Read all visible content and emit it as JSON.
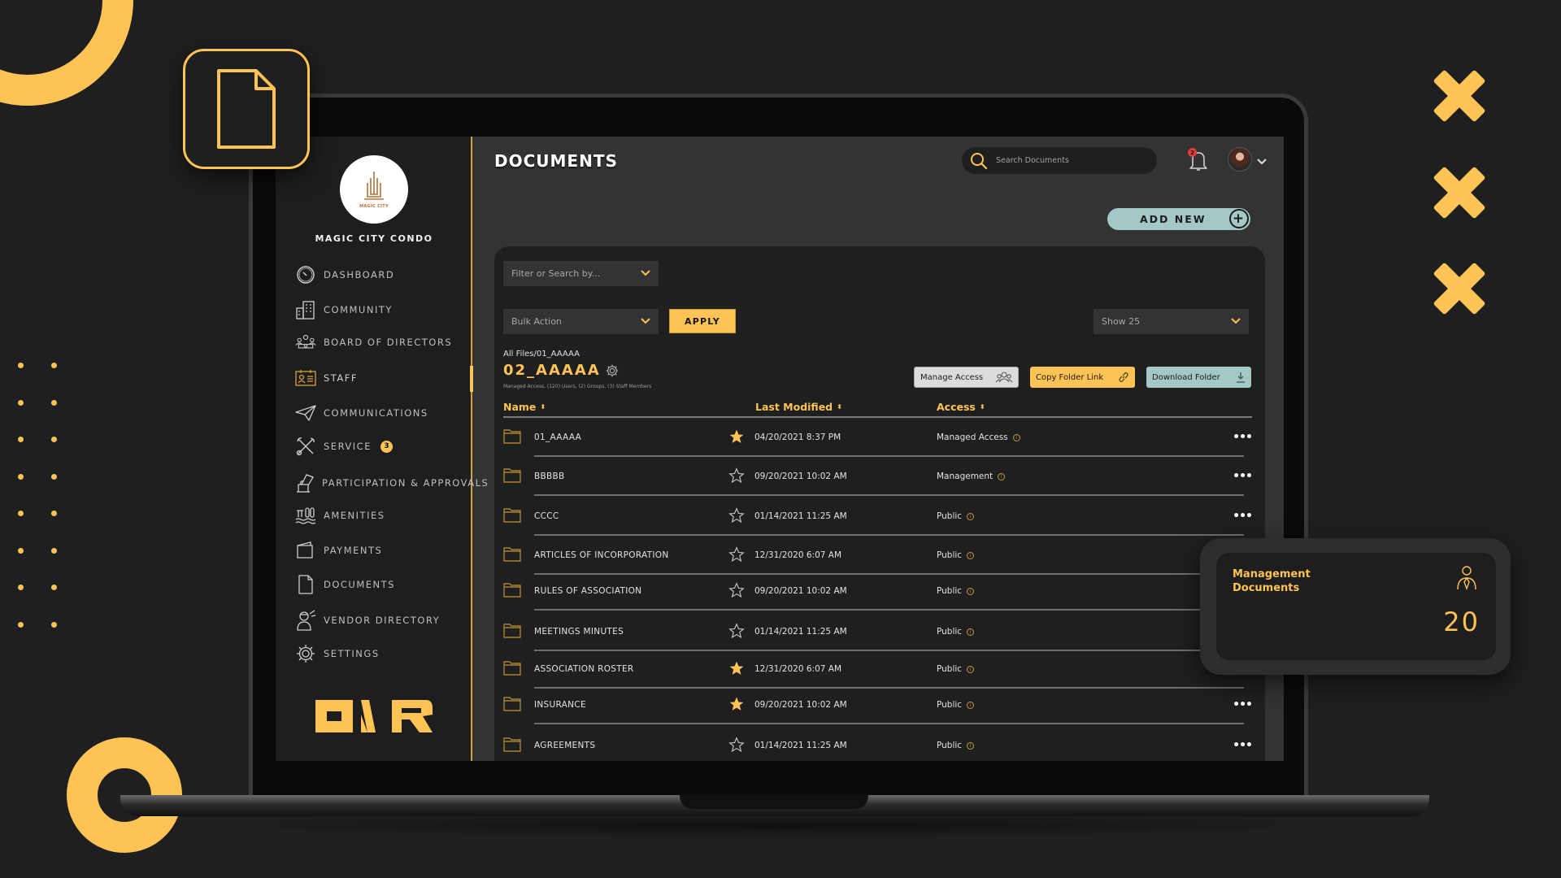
{
  "app": {
    "brand_name": "MAGIC CITY CONDO",
    "brand_logo_text": "MAGIC CITY",
    "accent_color": "#fdc354",
    "teal_color": "#a4c8c6"
  },
  "sidebar": {
    "items": [
      {
        "label": "DASHBOARD",
        "icon": "gauge-icon"
      },
      {
        "label": "COMMUNITY",
        "icon": "buildings-icon"
      },
      {
        "label": "BOARD OF DIRECTORS",
        "icon": "meeting-icon"
      },
      {
        "label": "STAFF",
        "icon": "id-badge-icon",
        "active": true
      },
      {
        "label": "COMMUNICATIONS",
        "icon": "paper-plane-icon"
      },
      {
        "label": "SERVICE",
        "icon": "tools-icon",
        "badge": "3"
      },
      {
        "label": "PARTICIPATION & APPROVALS",
        "icon": "ballot-icon"
      },
      {
        "label": "AMENITIES",
        "icon": "pool-icon"
      },
      {
        "label": "PAYMENTS",
        "icon": "wallet-icon"
      },
      {
        "label": "DOCUMENTS",
        "icon": "document-icon"
      },
      {
        "label": "VENDOR DIRECTORY",
        "icon": "vendor-icon"
      },
      {
        "label": "SETTINGS",
        "icon": "gear-icon"
      }
    ],
    "footer_logo": "ONR"
  },
  "header": {
    "title": "DOCUMENTS",
    "search_placeholder": "Search Documents",
    "notification_count": "2",
    "add_new_label": "ADD NEW"
  },
  "toolbar": {
    "filter_placeholder": "Filter or Search by...",
    "bulk_action_label": "Bulk Action",
    "apply_label": "APPLY",
    "show_label": "Show 25"
  },
  "folder": {
    "breadcrumb": "All Files/01_AAAAA",
    "title": "02_AAAAA",
    "subtitle": "Managed Access, (120) Users, (2) Groups, (3) Staff Members",
    "actions": {
      "manage_access": "Manage Access",
      "copy_link": "Copy Folder Link",
      "download": "Download Folder"
    }
  },
  "table": {
    "columns": [
      "Name",
      "Last Modified",
      "Access"
    ],
    "rows": [
      {
        "name": "01_AAAAA",
        "starred": true,
        "modified": "04/20/2021 8:37 PM",
        "access": "Managed Access"
      },
      {
        "name": "BBBBB",
        "starred": false,
        "modified": "09/20/2021 10:02 AM",
        "access": "Management"
      },
      {
        "name": "CCCC",
        "starred": false,
        "modified": "01/14/2021 11:25 AM",
        "access": "Public"
      },
      {
        "name": "ARTICLES OF INCORPORATION",
        "starred": false,
        "modified": "12/31/2020 6:07 AM",
        "access": "Public"
      },
      {
        "name": "RULES OF ASSOCIATION",
        "starred": false,
        "modified": "09/20/2021 10:02 AM",
        "access": "Public"
      },
      {
        "name": "MEETINGS MINUTES",
        "starred": false,
        "modified": "01/14/2021 11:25 AM",
        "access": "Public"
      },
      {
        "name": "ASSOCIATION ROSTER",
        "starred": true,
        "modified": "12/31/2020 6:07 AM",
        "access": "Public"
      },
      {
        "name": "INSURANCE",
        "starred": true,
        "modified": "09/20/2021 10:02 AM",
        "access": "Public"
      },
      {
        "name": "AGREEMENTS",
        "starred": false,
        "modified": "01/14/2021 11:25 AM",
        "access": "Public"
      }
    ],
    "more_label": "•••"
  },
  "stat_card": {
    "title": "Management Documents",
    "value": "20"
  }
}
